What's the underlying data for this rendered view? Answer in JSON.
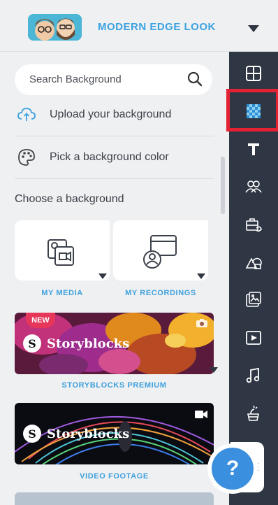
{
  "header": {
    "theme_name": "MODERN EDGE LOOK",
    "avatar_icon": "theme-characters-avatar",
    "caret_icon": "caret-down-icon"
  },
  "panel": {
    "search_placeholder": "Search Background",
    "upload_label": "Upload your background",
    "color_label": "Pick a background color",
    "choose_label": "Choose a background",
    "tiles": [
      {
        "caption": "MY MEDIA",
        "icon": "media-library-icon"
      },
      {
        "caption": "MY RECORDINGS",
        "icon": "recordings-icon"
      }
    ],
    "libraries": [
      {
        "caption": "STORYBLOCKS PREMIUM",
        "brand": "Storyblocks",
        "badge": "NEW",
        "type_icon": "camera-icon"
      },
      {
        "caption": "VIDEO FOOTAGE",
        "brand": "Storyblocks",
        "type_icon": "video-camera-icon"
      }
    ]
  },
  "toolbar": {
    "items": [
      {
        "name": "layout-icon"
      },
      {
        "name": "background-icon",
        "selected": true
      },
      {
        "name": "text-icon"
      },
      {
        "name": "characters-icon"
      },
      {
        "name": "props-icon"
      },
      {
        "name": "shapes-icon"
      },
      {
        "name": "image-icon"
      },
      {
        "name": "video-icon"
      },
      {
        "name": "music-icon"
      },
      {
        "name": "effects-icon"
      }
    ],
    "help_label": "?"
  },
  "colors": {
    "accent": "#3aa2e2",
    "toolbar_bg": "#2f3744",
    "highlight": "#e52134",
    "new_badge": "#e6375b"
  }
}
